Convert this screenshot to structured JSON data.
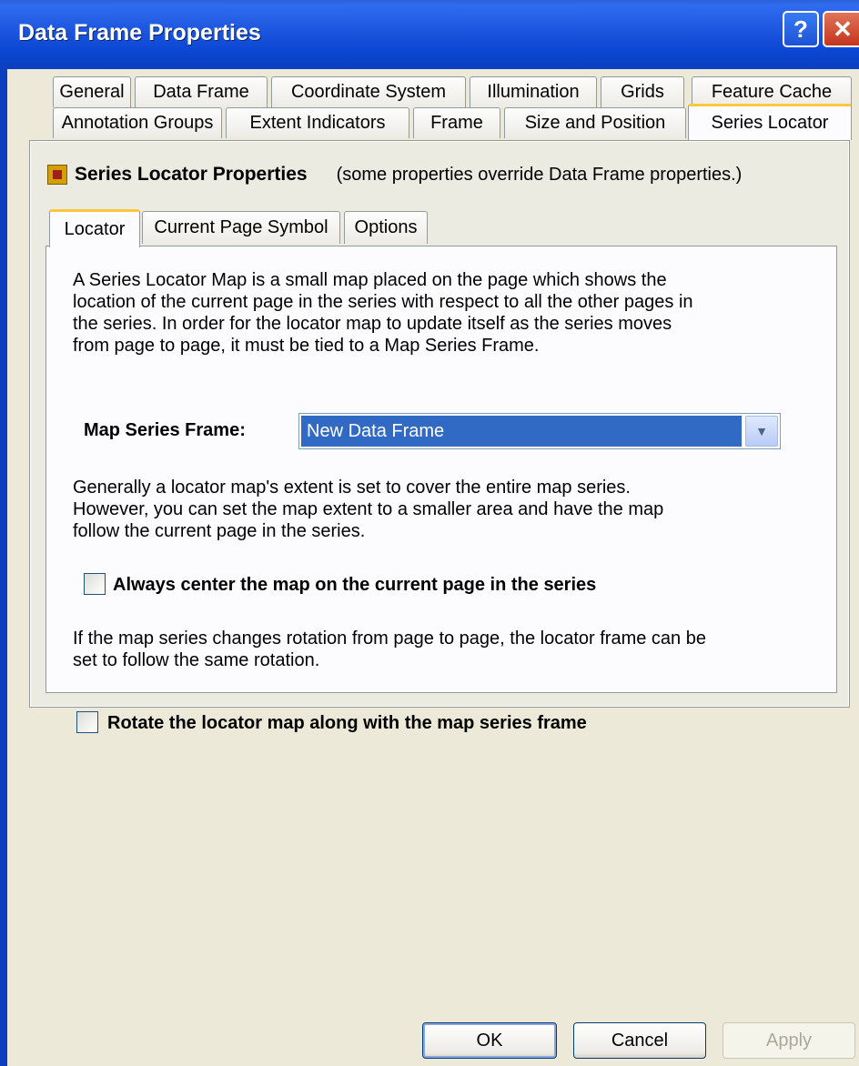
{
  "window": {
    "title": "Data Frame Properties",
    "help_glyph": "?",
    "close_glyph": "✕"
  },
  "tabs_row1": [
    "General",
    "Data Frame",
    "Coordinate System",
    "Illumination",
    "Grids",
    "Feature Cache"
  ],
  "tabs_row2": [
    "Annotation Groups",
    "Extent Indicators",
    "Frame",
    "Size and Position",
    "Series Locator"
  ],
  "active_tab": "Series Locator",
  "header": {
    "title": "Series Locator Properties",
    "note": "(some properties override Data Frame properties.)"
  },
  "subtabs": [
    "Locator",
    "Current Page Symbol",
    "Options"
  ],
  "active_subtab": "Locator",
  "locator": {
    "intro_lines": [
      "A Series Locator Map is a small map placed on the page which shows the",
      "location of the current page in the series with respect to all the other pages in",
      "the series.  In order for the locator map to update itself as the series moves",
      "from page to page, it must be tied to a Map Series Frame."
    ],
    "map_series_label": "Map Series Frame:",
    "map_series_value": "New Data Frame",
    "extent_lines": [
      "Generally a locator map's extent is set to cover the entire map series.",
      "However, you can set the map extent to a smaller area and have the map",
      "follow the current page in the series."
    ],
    "center_checkbox_label": "Always center the map on the current page in the series",
    "center_checked": false,
    "rotation_lines": [
      "If the map series changes rotation from page to page, the locator frame can be",
      "set to follow the same rotation."
    ],
    "rotate_checkbox_label": "Rotate the locator map along with the map series frame",
    "rotate_checked": false
  },
  "buttons": {
    "ok": "OK",
    "cancel": "Cancel",
    "apply": "Apply"
  },
  "colors": {
    "title_bar": "#0a46d2",
    "selection": "#316ac5",
    "active_tab_accent": "#ffc83c"
  }
}
